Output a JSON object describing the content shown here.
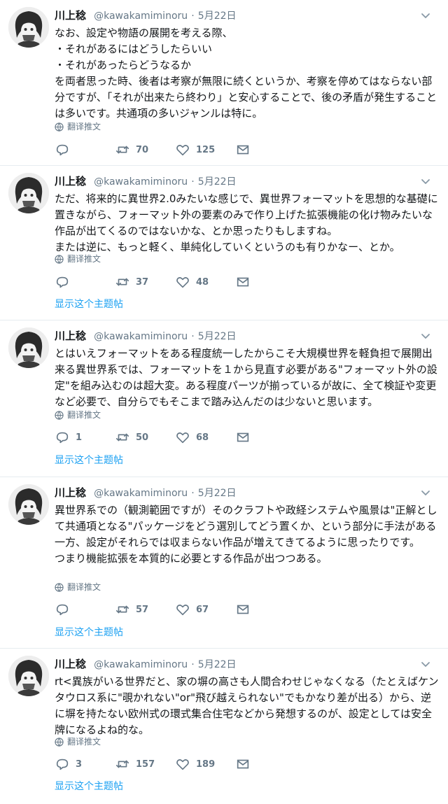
{
  "tweets": [
    {
      "name": "川上稔",
      "handle": "@kawakamiminoru",
      "dot": "·",
      "date": "5月22日",
      "text": "なお、設定や物語の展開を考える際、\n・それがあるにはどうしたらいい\n・それがあったらどうなるか\nを両者思った時、後者は考察が無限に続くというか、考察を停めてはならない部分ですが、「それが出来たら終わり」と安心することで、後の矛盾が発生することは多いです。共通項の多いジャンルは特に。",
      "translate": "翻译推文",
      "replies": "",
      "retweets": "70",
      "likes": "125",
      "show_thread": ""
    },
    {
      "name": "川上稔",
      "handle": "@kawakamiminoru",
      "dot": "·",
      "date": "5月22日",
      "text": "ただ、将来的に異世界2.0みたいな感じで、異世界フォーマットを思想的な基礎に置きながら、フォーマット外の要素のみで作り上げた拡張機能の化け物みたいな作品が出てくるのではないかな、とか思ったりもしますね。\nまたは逆に、もっと軽く、単純化していくというのも有りかなー、とか。",
      "translate": "翻译推文",
      "replies": "",
      "retweets": "37",
      "likes": "48",
      "show_thread": "显示这个主题帖"
    },
    {
      "name": "川上稔",
      "handle": "@kawakamiminoru",
      "dot": "·",
      "date": "5月22日",
      "text": "とはいえフォーマットをある程度統一したからこそ大規模世界を軽負担で展開出来る異世界系では、フォーマットを１から見直す必要がある\"フォーマット外の設定\"を組み込むのは超大変。ある程度パーツが揃っているが故に、全て検証や変更など必要で、自分らでもそこまで踏み込んだのは少ないと思います。",
      "translate": "翻译推文",
      "replies": "1",
      "retweets": "50",
      "likes": "68",
      "show_thread": "显示这个主题帖"
    },
    {
      "name": "川上稔",
      "handle": "@kawakamiminoru",
      "dot": "·",
      "date": "5月22日",
      "text": "異世界系での（観測範囲ですが）そのクラフトや政経システムや風景は\"正解として共通項となる\"パッケージをどう選別してどう置くか、という部分に手法がある一方、設定がそれらでは収まらない作品が増えてきてるように思ったりです。\nつまり機能拡張を本質的に必要とする作品が出つつある。",
      "translate": "翻译推文",
      "replies": "",
      "retweets": "57",
      "likes": "67",
      "show_thread": "显示这个主题帖"
    },
    {
      "name": "川上稔",
      "handle": "@kawakamiminoru",
      "dot": "·",
      "date": "5月22日",
      "text": "rt<異族がいる世界だと、家の塀の高さも人間合わせじゃなくなる（たとえばケンタウロス系に\"覗かれない\"or\"飛び越えられない\"でもかなり差が出る）から、逆に塀を持たない欧州式の環式集合住宅などから発想するのが、設定としては安全牌になるよね的な。",
      "translate": "翻译推文",
      "replies": "3",
      "retweets": "157",
      "likes": "189",
      "show_thread": "显示这个主题帖"
    }
  ]
}
